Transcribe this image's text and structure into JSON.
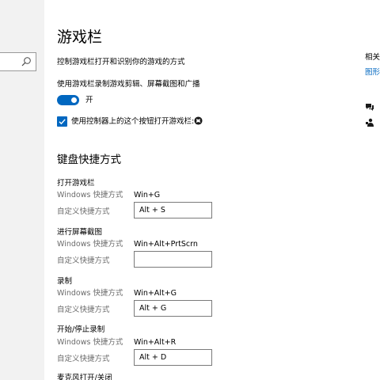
{
  "page": {
    "title": "游戏栏",
    "description": "控制游戏栏打开和识别你的游戏的方式"
  },
  "record_setting": {
    "label": "使用游戏栏录制游戏剪辑、屏幕截图和广播",
    "toggle_state": "开",
    "toggle_on": true
  },
  "controller_setting": {
    "label": "使用控制器上的这个按钮打开游戏栏:",
    "checked": true,
    "icon": "xbox-logo-icon"
  },
  "keyboard": {
    "title": "键盘快捷方式",
    "windows_label": "Windows 快捷方式",
    "custom_label": "自定义快捷方式",
    "groups": [
      {
        "label": "打开游戏栏",
        "windows_shortcut": "Win+G",
        "custom_shortcut": "Alt + S"
      },
      {
        "label": "进行屏幕截图",
        "windows_shortcut": "Win+Alt+PrtScrn",
        "custom_shortcut": ""
      },
      {
        "label": "录制",
        "windows_shortcut": "Win+Alt+G",
        "custom_shortcut": "Alt + G"
      },
      {
        "label": "开始/停止录制",
        "windows_shortcut": "Win+Alt+R",
        "custom_shortcut": "Alt + D"
      },
      {
        "label": "麦克风打开/关闭"
      }
    ]
  },
  "related": {
    "title": "相关",
    "link": "图形"
  },
  "colors": {
    "accent": "#0067c0",
    "secondary_text": "#6b6b6b",
    "nav_background": "#f2f2f2"
  }
}
